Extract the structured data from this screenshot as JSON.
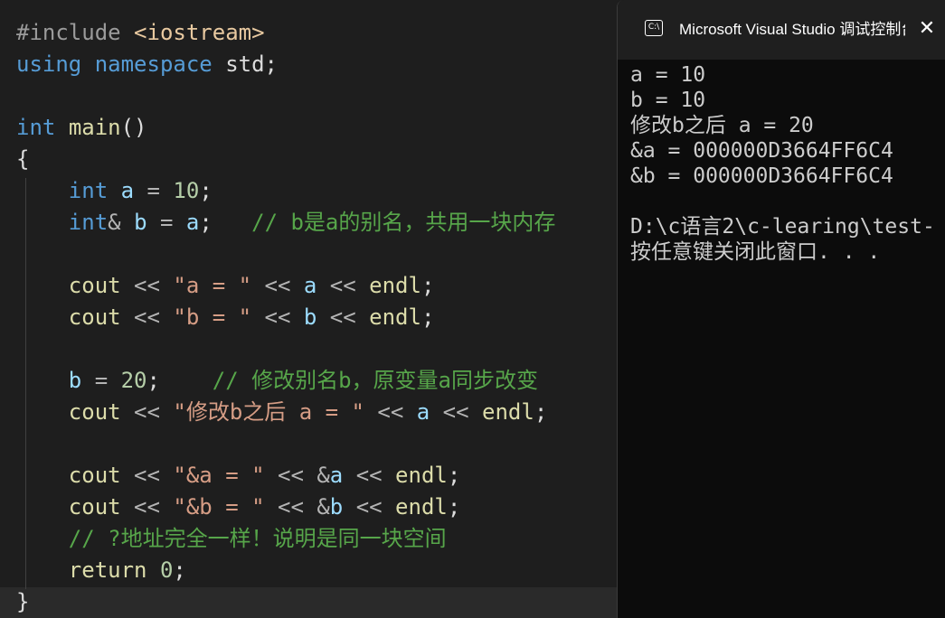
{
  "editor": {
    "lines": [
      [
        [
          "pp",
          "#include "
        ],
        [
          "inc",
          "<iostream>"
        ]
      ],
      [
        [
          "kw",
          "using"
        ],
        [
          "txt",
          " "
        ],
        [
          "kw",
          "namespace"
        ],
        [
          "txt",
          " std;"
        ]
      ],
      [],
      [
        [
          "kw",
          "int"
        ],
        [
          "txt",
          " "
        ],
        [
          "fn",
          "main"
        ],
        [
          "txt",
          "()"
        ]
      ],
      [
        [
          "txt",
          "{"
        ]
      ],
      [
        [
          "txt",
          "    "
        ],
        [
          "kw",
          "int"
        ],
        [
          "txt",
          " "
        ],
        [
          "var",
          "a"
        ],
        [
          "op",
          " = "
        ],
        [
          "num",
          "10"
        ],
        [
          "txt",
          ";"
        ]
      ],
      [
        [
          "txt",
          "    "
        ],
        [
          "kw",
          "int"
        ],
        [
          "op",
          "&"
        ],
        [
          "txt",
          " "
        ],
        [
          "var",
          "b"
        ],
        [
          "op",
          " = "
        ],
        [
          "var",
          "a"
        ],
        [
          "txt",
          ";   "
        ],
        [
          "cmt",
          "// b是a的别名，共用一块内存"
        ]
      ],
      [],
      [
        [
          "txt",
          "    "
        ],
        [
          "fn",
          "cout"
        ],
        [
          "op",
          " << "
        ],
        [
          "str",
          "\"a = \""
        ],
        [
          "op",
          " << "
        ],
        [
          "var",
          "a"
        ],
        [
          "op",
          " << "
        ],
        [
          "fn",
          "endl"
        ],
        [
          "txt",
          ";"
        ]
      ],
      [
        [
          "txt",
          "    "
        ],
        [
          "fn",
          "cout"
        ],
        [
          "op",
          " << "
        ],
        [
          "str",
          "\"b = \""
        ],
        [
          "op",
          " << "
        ],
        [
          "var",
          "b"
        ],
        [
          "op",
          " << "
        ],
        [
          "fn",
          "endl"
        ],
        [
          "txt",
          ";"
        ]
      ],
      [],
      [
        [
          "txt",
          "    "
        ],
        [
          "var",
          "b"
        ],
        [
          "op",
          " = "
        ],
        [
          "num",
          "20"
        ],
        [
          "txt",
          ";    "
        ],
        [
          "cmt",
          "// 修改别名b，原变量a同步改变"
        ]
      ],
      [
        [
          "txt",
          "    "
        ],
        [
          "fn",
          "cout"
        ],
        [
          "op",
          " << "
        ],
        [
          "str",
          "\"修改b之后 a = \""
        ],
        [
          "op",
          " << "
        ],
        [
          "var",
          "a"
        ],
        [
          "op",
          " << "
        ],
        [
          "fn",
          "endl"
        ],
        [
          "txt",
          ";"
        ]
      ],
      [],
      [
        [
          "txt",
          "    "
        ],
        [
          "fn",
          "cout"
        ],
        [
          "op",
          " << "
        ],
        [
          "str",
          "\"&a = \""
        ],
        [
          "op",
          " << &"
        ],
        [
          "var",
          "a"
        ],
        [
          "op",
          " << "
        ],
        [
          "fn",
          "endl"
        ],
        [
          "txt",
          ";"
        ]
      ],
      [
        [
          "txt",
          "    "
        ],
        [
          "fn",
          "cout"
        ],
        [
          "op",
          " << "
        ],
        [
          "str",
          "\"&b = \""
        ],
        [
          "op",
          " << &"
        ],
        [
          "var",
          "b"
        ],
        [
          "op",
          " << "
        ],
        [
          "fn",
          "endl"
        ],
        [
          "txt",
          ";"
        ]
      ],
      [
        [
          "txt",
          "    "
        ],
        [
          "cmt",
          "// ?地址完全一样！说明是同一块空间"
        ]
      ],
      [
        [
          "txt",
          "    "
        ],
        [
          "fn",
          "return"
        ],
        [
          "txt",
          " "
        ],
        [
          "num",
          "0"
        ],
        [
          "txt",
          ";"
        ]
      ],
      [
        [
          "txt",
          "}"
        ]
      ]
    ]
  },
  "console": {
    "icon": "terminal-icon",
    "title": "Microsoft Visual Studio 调试控制台",
    "close_icon": "close-icon",
    "close_glyph": "✕",
    "output": [
      "a = 10",
      "b = 10",
      "修改b之后 a = 20",
      "&a = 000000D3664FF6C4",
      "&b = 000000D3664FF6C4",
      "",
      "D:\\c语言2\\c-learing\\test-",
      "按任意键关闭此窗口. . ."
    ]
  }
}
